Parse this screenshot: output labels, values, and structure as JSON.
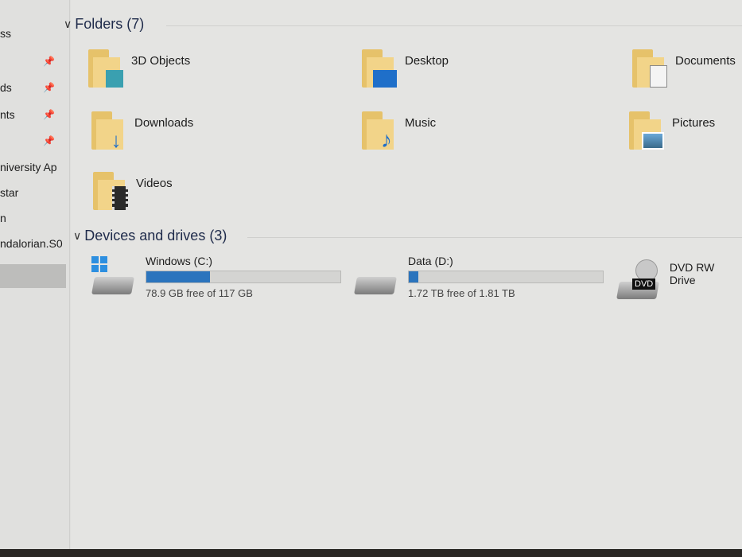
{
  "sidebar": {
    "items": [
      "ss",
      "",
      "ds",
      "nts",
      "",
      "niversity Ap",
      "star",
      "n",
      "ndalorian.S0"
    ]
  },
  "folders_section": {
    "title": "Folders (7)",
    "items": [
      {
        "label": "3D Objects",
        "icon": "cube-icon"
      },
      {
        "label": "Desktop",
        "icon": "desktop-icon"
      },
      {
        "label": "Documents",
        "icon": "document-icon"
      },
      {
        "label": "Downloads",
        "icon": "download-arrow-icon"
      },
      {
        "label": "Music",
        "icon": "music-note-icon"
      },
      {
        "label": "Pictures",
        "icon": "picture-icon"
      },
      {
        "label": "Videos",
        "icon": "film-icon"
      }
    ]
  },
  "drives_section": {
    "title": "Devices and drives (3)",
    "items": [
      {
        "label": "Windows (C:)",
        "free": "78.9 GB free of 117 GB",
        "used_fraction": 0.326
      },
      {
        "label": "Data (D:)",
        "free": "1.72 TB free of 1.81 TB",
        "used_fraction": 0.05
      },
      {
        "label": "DVD RW Drive",
        "badge": "DVD"
      }
    ]
  },
  "colors": {
    "accent": "#2b74bd"
  }
}
